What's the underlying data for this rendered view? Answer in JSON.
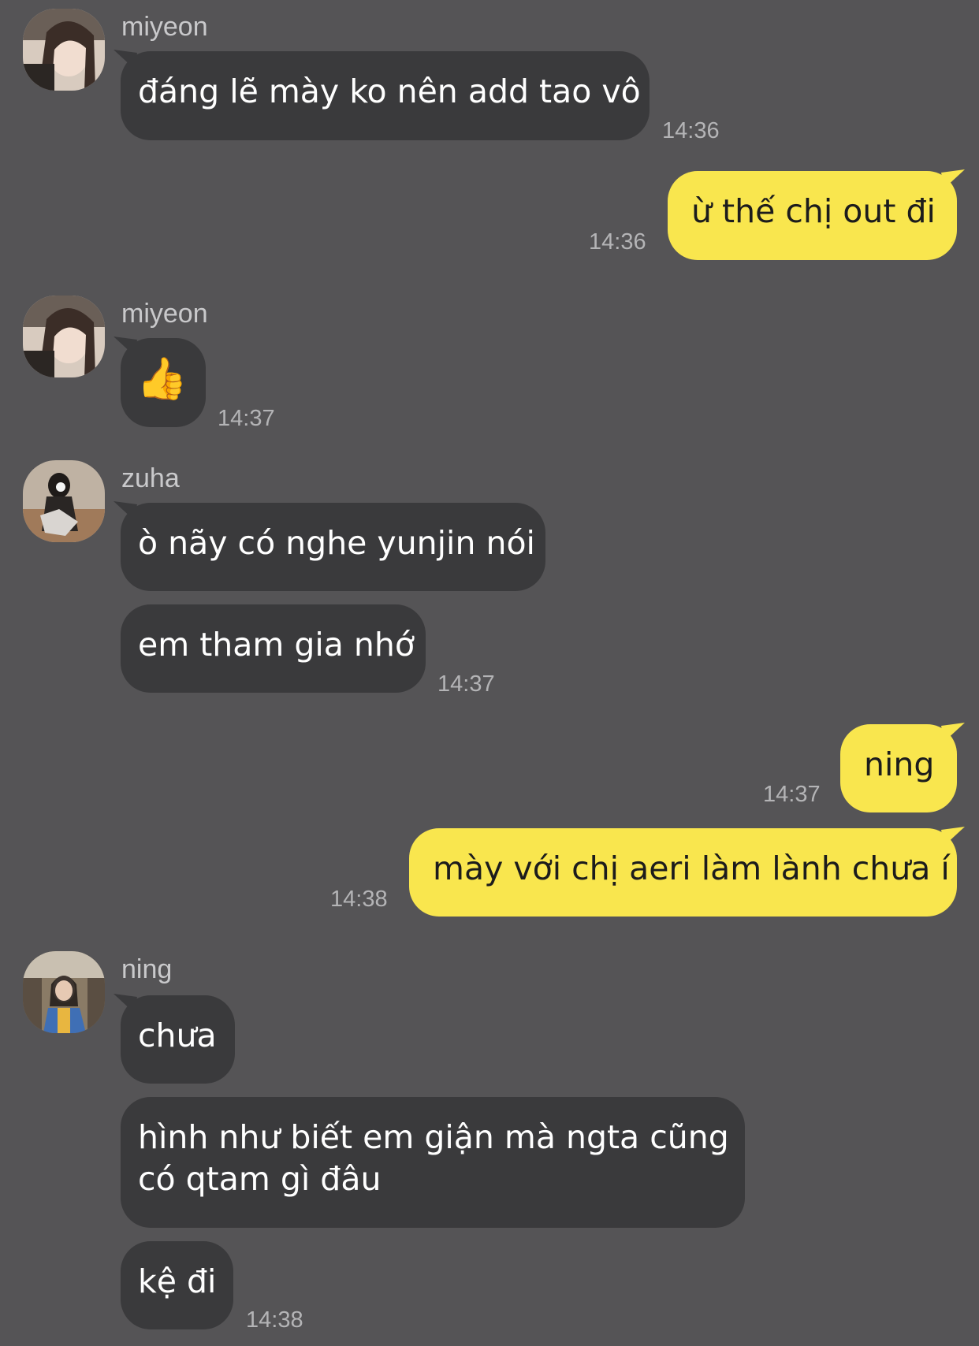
{
  "messages": [
    {
      "sender": "miyeon",
      "text": "đáng lẽ mày ko nên add tao vô",
      "time": "14:36"
    },
    {
      "sender": "me",
      "text": "ừ thế chị out đi",
      "time": "14:36"
    },
    {
      "sender": "miyeon",
      "text": "👍",
      "time": "14:37"
    },
    {
      "sender": "zuha",
      "text": "ò nãy có nghe yunjin nói"
    },
    {
      "sender": "zuha",
      "text": "em tham gia nhớ",
      "time": "14:37"
    },
    {
      "sender": "me",
      "text": "ning",
      "time": "14:37"
    },
    {
      "sender": "me",
      "text": "mày với chị aeri làm lành chưa í",
      "time": "14:38"
    },
    {
      "sender": "ning",
      "text": "chưa"
    },
    {
      "sender": "ning",
      "text_line1": "hình như biết em giận mà ngta cũng",
      "text_line2": "có qtam gì đâu"
    },
    {
      "sender": "ning",
      "text": "kệ đi",
      "time": "14:38"
    }
  ],
  "colors": {
    "background": "#555456",
    "incoming_bubble": "#3a3a3c",
    "outgoing_bubble": "#f9e64e"
  }
}
